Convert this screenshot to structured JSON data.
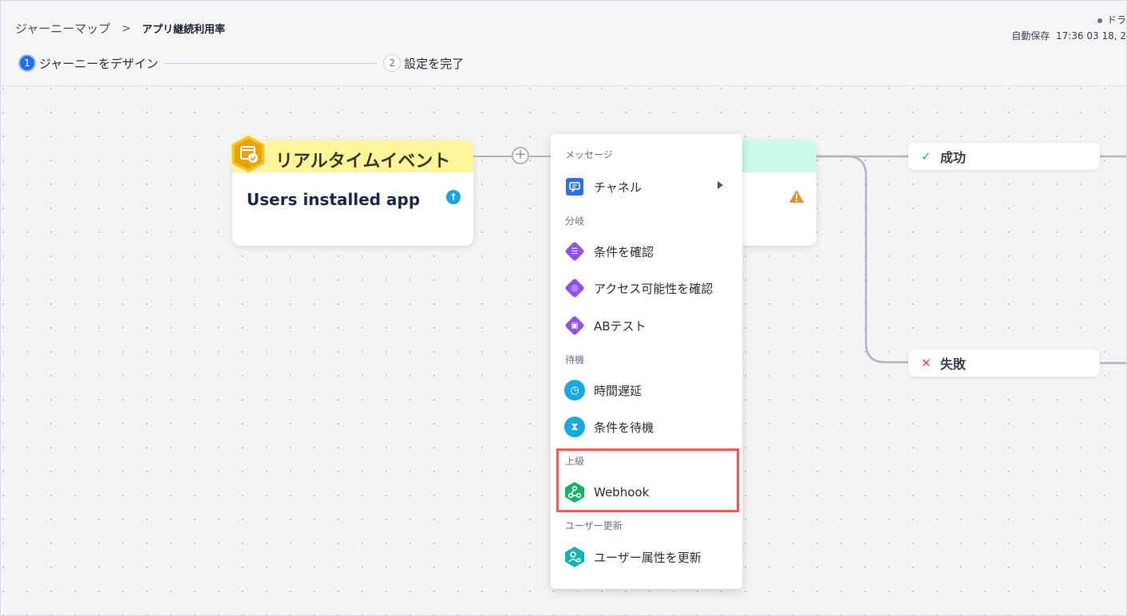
{
  "header": {
    "breadcrumb": {
      "parent": "ジャーニーマップ",
      "separator": ">",
      "current": "アプリ継続利用率"
    },
    "status": {
      "badge": "ドラ",
      "autosave_label": "自動保存",
      "autosave_time": "17:36 03 18, 2"
    },
    "steps": [
      {
        "number": "1",
        "label": "ジャーニーをデザイン",
        "active": true
      },
      {
        "number": "2",
        "label": "設定を完了",
        "active": false
      }
    ]
  },
  "canvas": {
    "event_card": {
      "title": "リアルタイムイベント",
      "body": "Users installed app",
      "color": "#fff59a",
      "icon": "calendar-check-icon"
    },
    "branches": {
      "success": "成功",
      "fail": "失敗"
    },
    "add_button": "+"
  },
  "menu": {
    "sections": [
      {
        "label": "メッセージ",
        "items": [
          {
            "label": "チャネル",
            "icon": "chat-icon",
            "submenu": true
          }
        ]
      },
      {
        "label": "分岐",
        "items": [
          {
            "label": "条件を確認",
            "icon": "list-icon"
          },
          {
            "label": "アクセス可能性を確認",
            "icon": "reach-icon"
          },
          {
            "label": "ABテスト",
            "icon": "ab-test-icon"
          }
        ]
      },
      {
        "label": "待機",
        "items": [
          {
            "label": "時間遅延",
            "icon": "clock-icon"
          },
          {
            "label": "条件を待機",
            "icon": "hourglass-icon"
          }
        ]
      },
      {
        "label": "上級",
        "items": [
          {
            "label": "Webhook",
            "icon": "webhook-icon"
          }
        ]
      },
      {
        "label": "ユーザー更新",
        "items": [
          {
            "label": "ユーザー属性を更新",
            "icon": "user-attribute-icon"
          }
        ]
      }
    ]
  },
  "colors": {
    "accent": "#1f6fe5",
    "branch_purple": "#8f53e8",
    "wait_blue": "#1ba7e0",
    "webhook_green": "#18b06a",
    "user_teal": "#12b3b0",
    "highlight": "#ef5b5b"
  }
}
